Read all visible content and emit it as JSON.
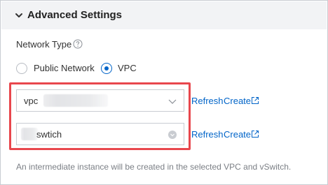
{
  "section": {
    "title": "Advanced Settings"
  },
  "network_type": {
    "label": "Network Type",
    "options": [
      {
        "label": "Public Network",
        "selected": false
      },
      {
        "label": "VPC",
        "selected": true
      }
    ]
  },
  "vpc_select": {
    "value": "vpc",
    "refresh_label": "Refresh",
    "create_label": "Create"
  },
  "vswitch_select": {
    "value": "swtich",
    "refresh_label": "Refresh",
    "create_label": "Create"
  },
  "hint": "An intermediate instance will be created in the selected VPC and vSwitch.",
  "colors": {
    "accent": "#0064c8",
    "highlight_border": "#e8474d",
    "header_bg": "#f2f3f5"
  }
}
